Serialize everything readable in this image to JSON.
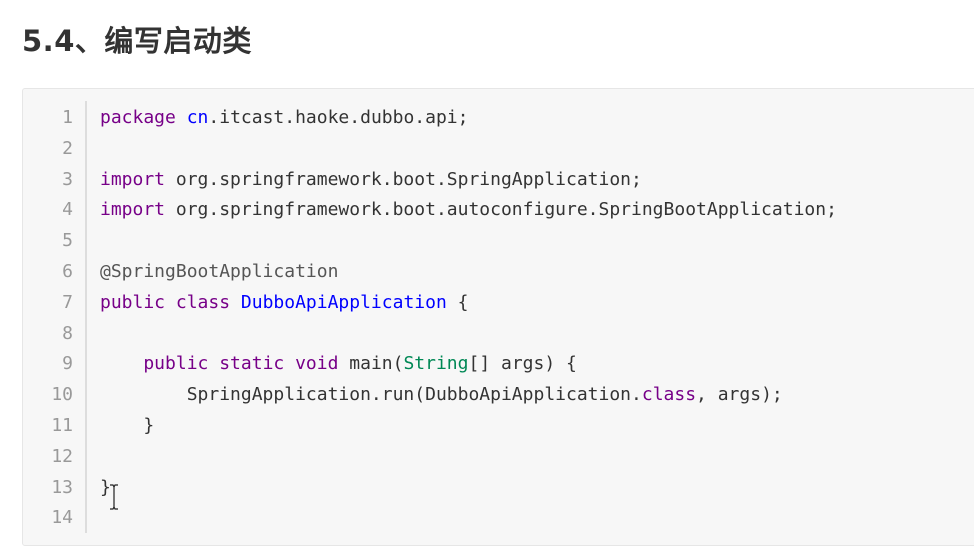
{
  "heading": "5.4、编写启动类",
  "code_lines": [
    {
      "num": "1",
      "segments": [
        {
          "t": "package ",
          "c": "kw"
        },
        {
          "t": "cn",
          "c": "pkg"
        },
        {
          "t": ".itcast.haoke.dubbo.api;",
          "c": "plain"
        }
      ]
    },
    {
      "num": "2",
      "segments": []
    },
    {
      "num": "3",
      "segments": [
        {
          "t": "import ",
          "c": "kw"
        },
        {
          "t": "org.springframework.boot.SpringApplication;",
          "c": "plain"
        }
      ]
    },
    {
      "num": "4",
      "segments": [
        {
          "t": "import ",
          "c": "kw"
        },
        {
          "t": "org.springframework.boot.autoconfigure.SpringBootApplication;",
          "c": "plain"
        }
      ]
    },
    {
      "num": "5",
      "segments": []
    },
    {
      "num": "6",
      "segments": [
        {
          "t": "@SpringBootApplication",
          "c": "meta"
        }
      ]
    },
    {
      "num": "7",
      "segments": [
        {
          "t": "public ",
          "c": "kw"
        },
        {
          "t": "class ",
          "c": "kw"
        },
        {
          "t": "DubboApiApplication",
          "c": "type"
        },
        {
          "t": " {",
          "c": "plain"
        }
      ]
    },
    {
      "num": "8",
      "segments": []
    },
    {
      "num": "9",
      "segments": [
        {
          "t": "    public ",
          "c": "kw"
        },
        {
          "t": "static ",
          "c": "kw"
        },
        {
          "t": "void ",
          "c": "kw"
        },
        {
          "t": "main(",
          "c": "plain"
        },
        {
          "t": "String",
          "c": "builtin"
        },
        {
          "t": "[] args) {",
          "c": "plain"
        }
      ]
    },
    {
      "num": "10",
      "segments": [
        {
          "t": "        SpringApplication.run(DubboApiApplication.",
          "c": "plain"
        },
        {
          "t": "class",
          "c": "kw"
        },
        {
          "t": ", args);",
          "c": "plain"
        }
      ]
    },
    {
      "num": "11",
      "segments": [
        {
          "t": "    }",
          "c": "plain"
        }
      ]
    },
    {
      "num": "12",
      "segments": []
    },
    {
      "num": "13",
      "segments": [
        {
          "t": "}",
          "c": "plain"
        }
      ]
    },
    {
      "num": "14",
      "segments": []
    }
  ],
  "cursor_icon": "text-cursor-icon"
}
